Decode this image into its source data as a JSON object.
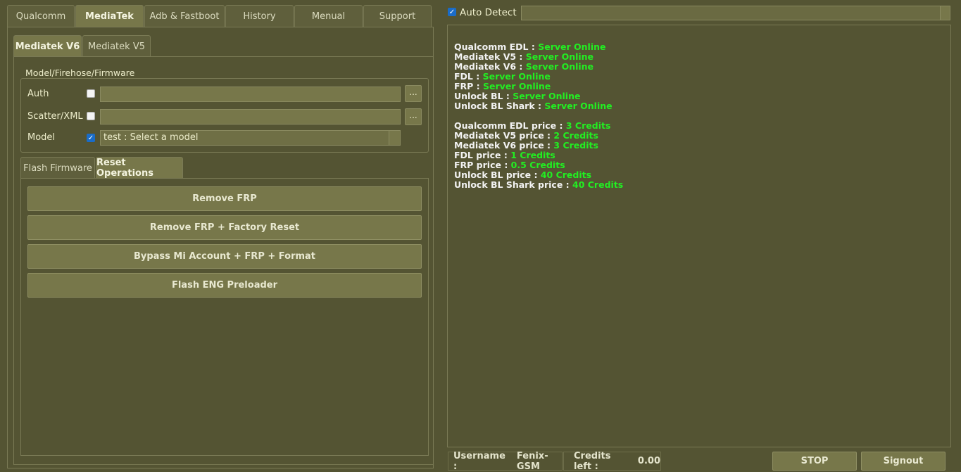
{
  "main_tabs": [
    {
      "label": "Qualcomm"
    },
    {
      "label": "MediaTek",
      "active": true
    },
    {
      "label": "Adb & Fastboot"
    },
    {
      "label": "History"
    },
    {
      "label": "Menual"
    },
    {
      "label": "Support"
    }
  ],
  "sub_tabs": [
    {
      "label": "Mediatek V6",
      "active": true
    },
    {
      "label": "Mediatek V5"
    }
  ],
  "group": {
    "title": "Model/Firehose/Firmware",
    "auth_label": "Auth",
    "auth_checked": false,
    "auth_value": "",
    "scatter_label": "Scatter/XML",
    "scatter_checked": false,
    "scatter_value": "",
    "browse_label": "...",
    "model_label": "Model",
    "model_checked": true,
    "model_value": "test : Select a model"
  },
  "op_tabs": [
    {
      "label": "Flash Firmware"
    },
    {
      "label": "Reset Operations",
      "active": true
    }
  ],
  "operations": [
    "Remove FRP",
    "Remove FRP + Factory Reset",
    "Bypass Mi Account + FRP + Format",
    "Flash ENG Preloader"
  ],
  "auto_detect": {
    "label": "Auto Detect",
    "checked": true,
    "value": ""
  },
  "log": {
    "status": [
      {
        "key": "Qualcomm EDL : ",
        "value": "Server Online"
      },
      {
        "key": "Mediatek V5 : ",
        "value": "Server Online"
      },
      {
        "key": "Mediatek V6 : ",
        "value": "Server Online"
      },
      {
        "key": "FDL : ",
        "value": "Server Online"
      },
      {
        "key": "FRP : ",
        "value": "Server Online"
      },
      {
        "key": "Unlock BL : ",
        "value": "Server Online"
      },
      {
        "key": "Unlock BL Shark : ",
        "value": "Server Online"
      }
    ],
    "prices": [
      {
        "key": "Qualcomm EDL price : ",
        "value": "3 Credits"
      },
      {
        "key": "Mediatek V5 price : ",
        "value": "2 Credits"
      },
      {
        "key": "Mediatek V6 price : ",
        "value": "3 Credits"
      },
      {
        "key": "FDL price : ",
        "value": "1 Credits"
      },
      {
        "key": "FRP price : ",
        "value": "0.5 Credits"
      },
      {
        "key": "Unlock BL price : ",
        "value": "40 Credits"
      },
      {
        "key": "Unlock BL Shark price : ",
        "value": "40 Credits"
      }
    ],
    "online_color": "#22ee22"
  },
  "status_bar": {
    "username_label": "Username :",
    "username": "Fenix-GSM",
    "credits_label": "Credits left :",
    "credits": "0.00"
  },
  "buttons": {
    "stop": "STOP",
    "signout": "Signout"
  }
}
